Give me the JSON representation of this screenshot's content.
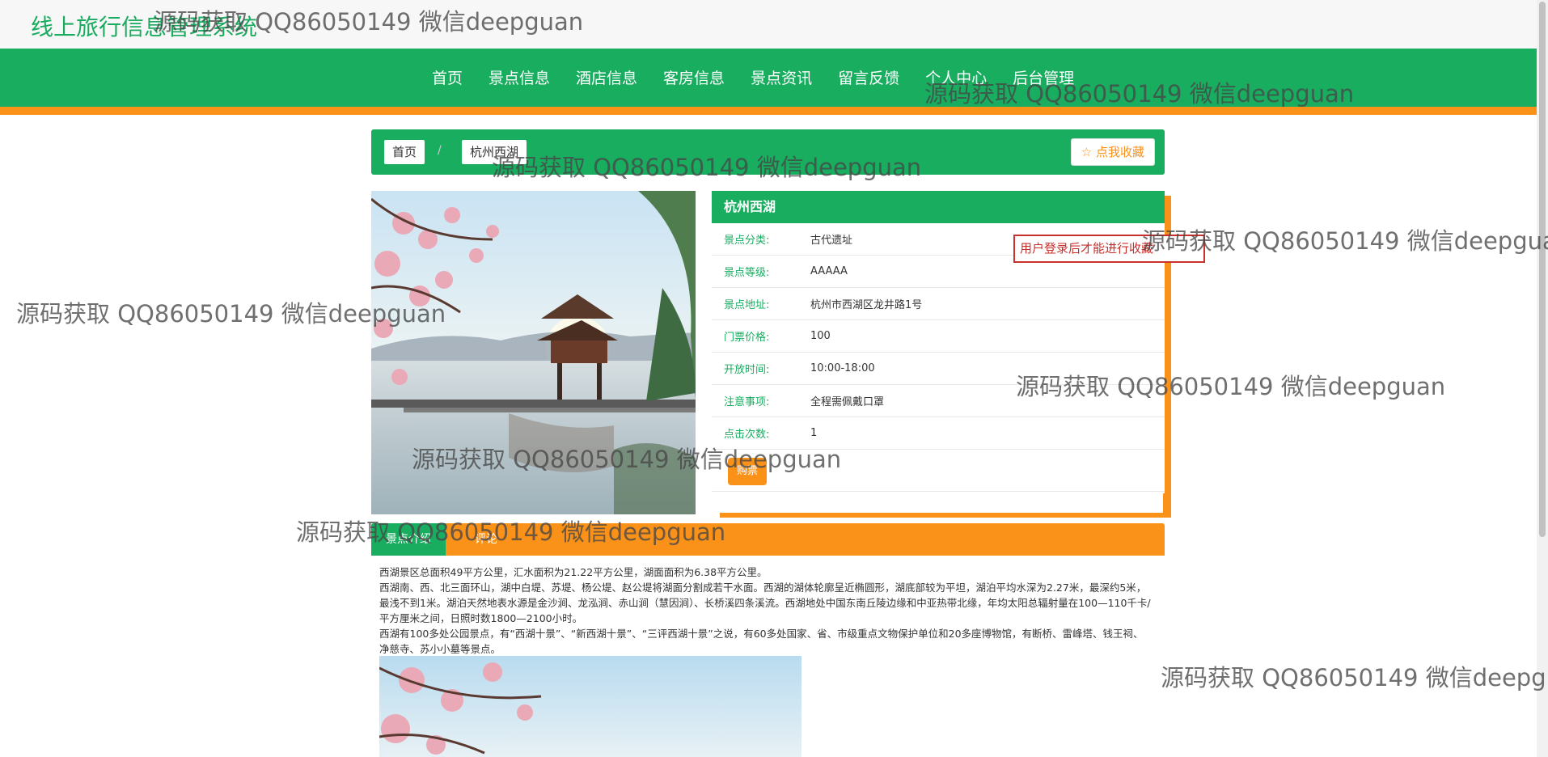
{
  "site": {
    "title": "线上旅行信息管理系统"
  },
  "nav": {
    "items": [
      "首页",
      "景点信息",
      "酒店信息",
      "客房信息",
      "景点资讯",
      "留言反馈",
      "个人中心",
      "后台管理"
    ]
  },
  "breadcrumb": {
    "home": "首页",
    "current": "杭州西湖"
  },
  "favorite_button": {
    "label": "☆ 点我收藏"
  },
  "info": {
    "title": "杭州西湖",
    "rows": [
      {
        "label": "景点分类:",
        "value": "古代遗址"
      },
      {
        "label": "景点等级:",
        "value": "AAAAA"
      },
      {
        "label": "景点地址:",
        "value": "杭州市西湖区龙井路1号"
      },
      {
        "label": "门票价格:",
        "value": "100"
      },
      {
        "label": "开放时间:",
        "value": "10:00-18:00"
      },
      {
        "label": "注意事项:",
        "value": "全程需佩戴口罩"
      },
      {
        "label": "点击次数:",
        "value": "1"
      }
    ],
    "buy_label": "购票"
  },
  "login_tip": "用户登录后才能进行收藏",
  "tabs": {
    "intro": "景点介绍",
    "comments": "评论"
  },
  "description": [
    "西湖景区总面积49平方公里，汇水面积为21.22平方公里，湖面面积为6.38平方公里。",
    "西湖南、西、北三面环山，湖中白堤、苏堤、杨公堤、赵公堤将湖面分割成若干水面。西湖的湖体轮廓呈近椭圆形，湖底部较为平坦，湖泊平均水深为2.27米，最深约5米，最浅不到1米。湖泊天然地表水源是金沙涧、龙泓涧、赤山涧（慧因涧）、长桥溪四条溪流。西湖地处中国东南丘陵边缘和中亚热带北缘，年均太阳总辐射量在100—110千卡/平方厘米之间，日照时数1800—2100小时。",
    "西湖有100多处公园景点，有“西湖十景”、“新西湖十景”、“三评西湖十景”之说，有60多处国家、省、市级重点文物保护单位和20多座博物馆，有断桥、雷峰塔、钱王祠、净慈寺、苏小小墓等景点。"
  ],
  "watermark": "源码获取 QQ86050149 微信deepguan"
}
